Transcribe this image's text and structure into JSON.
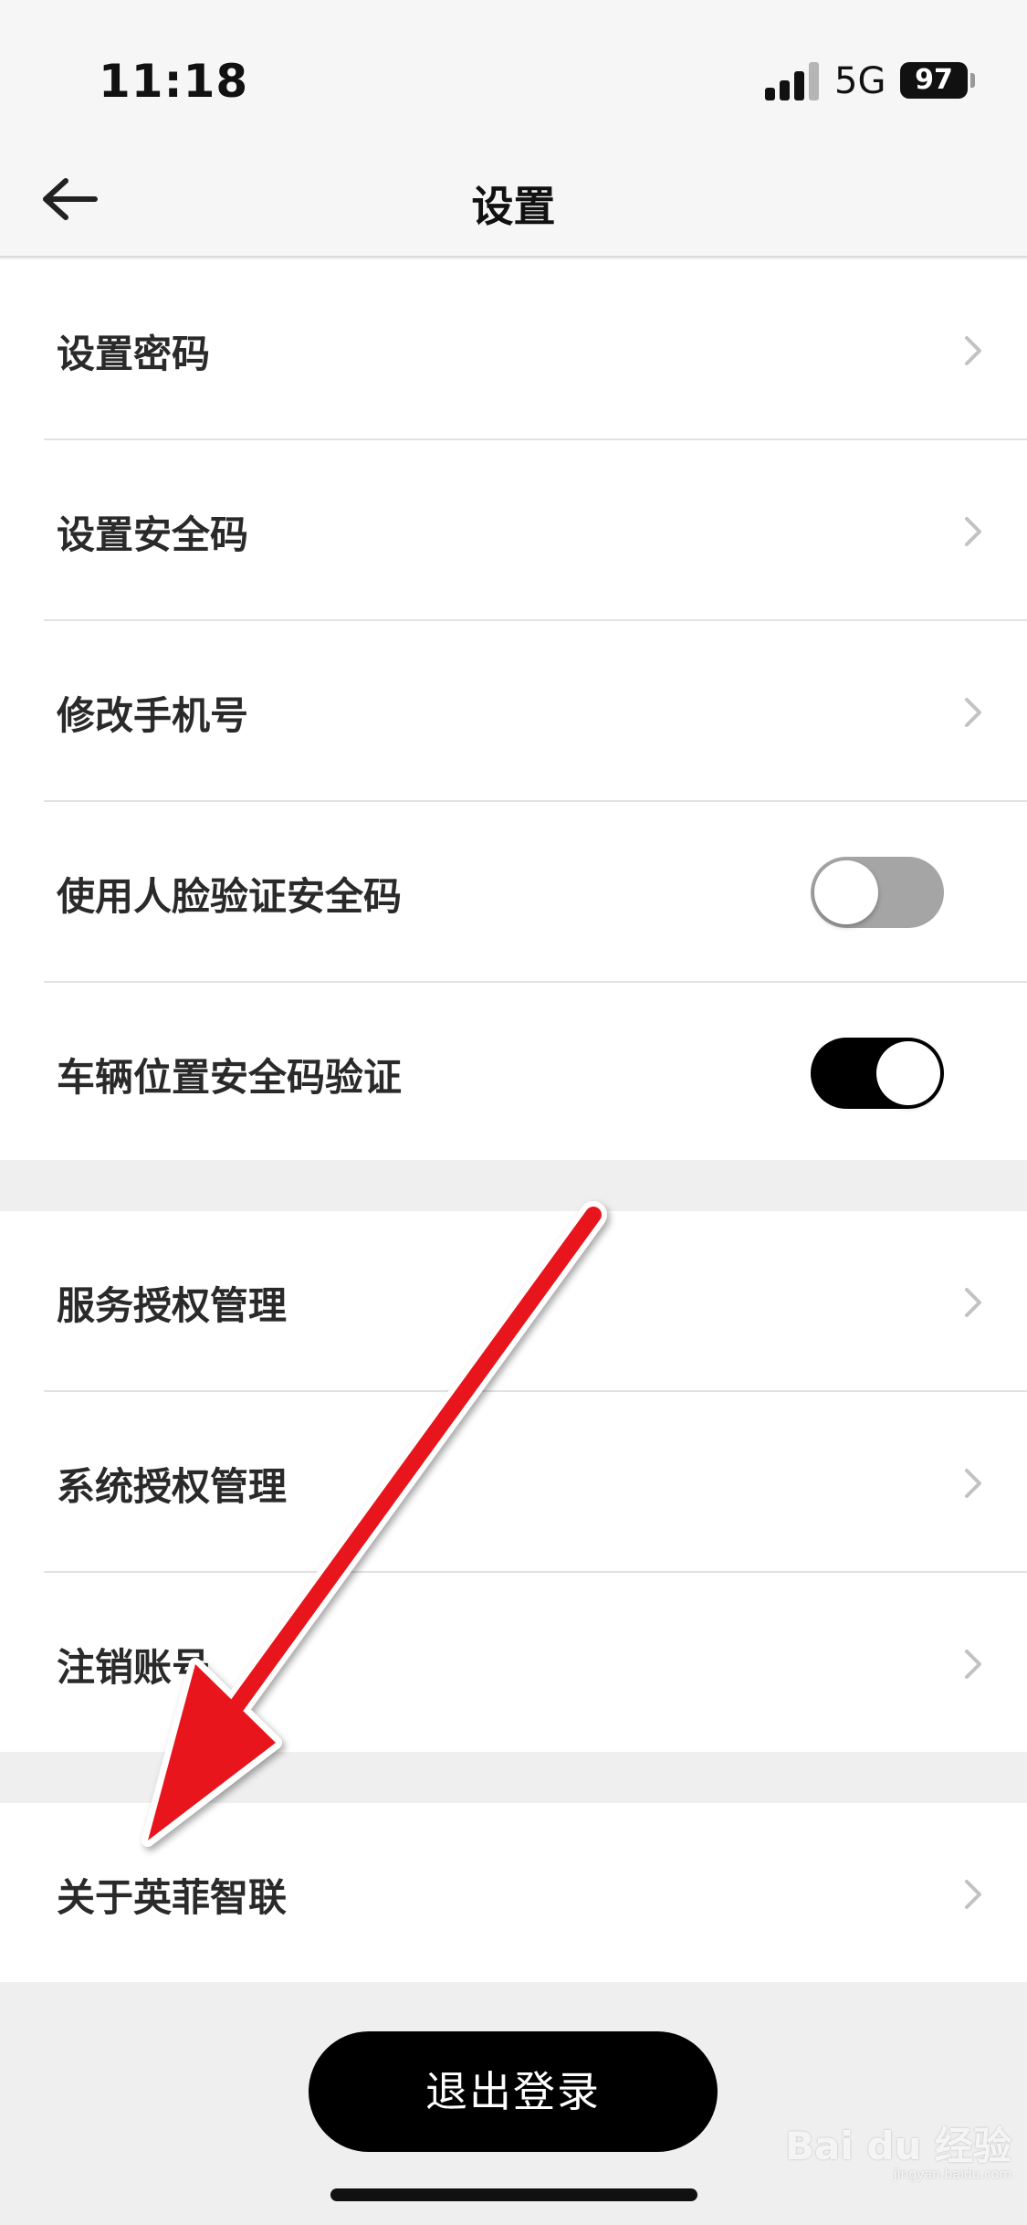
{
  "status": {
    "time": "11:18",
    "network": "5G",
    "battery": "97"
  },
  "nav": {
    "back_icon": "arrow-left-icon",
    "title": "设置"
  },
  "group1": {
    "items": [
      {
        "label": "设置密码",
        "type": "link"
      },
      {
        "label": "设置安全码",
        "type": "link"
      },
      {
        "label": "修改手机号",
        "type": "link"
      },
      {
        "label": "使用人脸验证安全码",
        "type": "toggle",
        "on": false
      },
      {
        "label": "车辆位置安全码验证",
        "type": "toggle",
        "on": true
      }
    ]
  },
  "group2": {
    "items": [
      {
        "label": "服务授权管理",
        "type": "link"
      },
      {
        "label": "系统授权管理",
        "type": "link"
      },
      {
        "label": "注销账号",
        "type": "link"
      }
    ]
  },
  "group3": {
    "items": [
      {
        "label": "关于英菲智联",
        "type": "link"
      }
    ]
  },
  "logout_label": "退出登录",
  "watermark": {
    "text": "Bai du 经验",
    "sub": "jingyan.baidu.com"
  },
  "colors": {
    "toggle_on": "#000000",
    "toggle_off": "#a5a5a5",
    "annotation_arrow": "#e8141b"
  }
}
